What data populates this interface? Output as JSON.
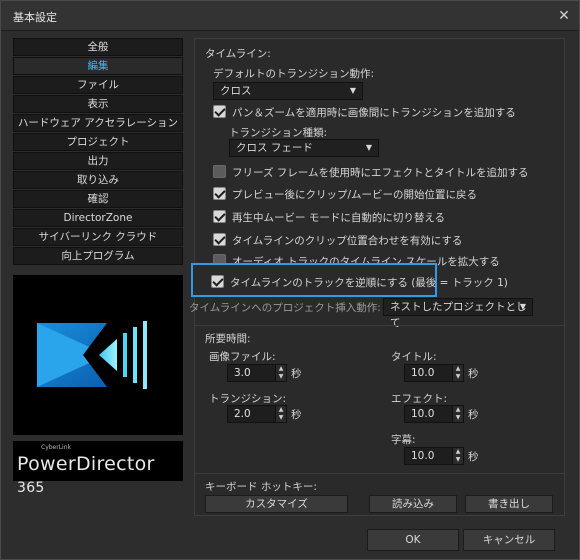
{
  "window": {
    "title": "基本設定",
    "close_icon": "close-icon"
  },
  "sidebar": {
    "items": [
      {
        "label": "全般"
      },
      {
        "label": "編集"
      },
      {
        "label": "ファイル"
      },
      {
        "label": "表示"
      },
      {
        "label": "ハードウェア アクセラレーション"
      },
      {
        "label": "プロジェクト"
      },
      {
        "label": "出力"
      },
      {
        "label": "取り込み"
      },
      {
        "label": "確認"
      },
      {
        "label": "DirectorZone"
      },
      {
        "label": "サイバーリンク クラウド"
      },
      {
        "label": "向上プログラム"
      }
    ],
    "active_index": 1,
    "accent_color": "#48b4f5"
  },
  "brand": {
    "small": "CyberLink",
    "name": "PowerDirector",
    "version": "365"
  },
  "timeline": {
    "section_label": "タイムライン:",
    "default_transition_label": "デフォルトのトランジション動作:",
    "default_transition_value": "クロス",
    "pan_zoom_label": "パン＆ズームを適用時に画像間にトランジションを追加する",
    "transition_type_label": "トランジション種類:",
    "transition_type_value": "クロス フェード",
    "freeze_label": "フリーズ フレームを使用時にエフェクトとタイトルを追加する",
    "preview_label": "プレビュー後にクリップ/ムービーの開始位置に戻る",
    "playback_label": "再生中ムービー モードに自動的に切り替える",
    "snap_label": "タイムラインのクリップ位置合わせを有効にする",
    "audio_partial_label": "オーディオ トラックのタイムライン スケールを拡大する",
    "reverse_label": "タイムラインのトラックを逆順にする (最後 = トラック 1)",
    "insert_partial_label": "タイムラインへのプロジェクト挿入動作:",
    "insert_partial_value": "ネストしたプロジェクトとして"
  },
  "duration": {
    "section_label": "所要時間:",
    "image_label": "画像ファイル:",
    "image_value": "3.0",
    "transition_label": "トランジション:",
    "transition_value": "2.0",
    "title_label": "タイトル:",
    "title_value": "10.0",
    "effect_label": "エフェクト:",
    "effect_value": "10.0",
    "subtitle_label": "字幕:",
    "subtitle_value": "10.0",
    "unit": "秒"
  },
  "hotkeys": {
    "label": "キーボード ホットキー:",
    "customize": "カスタマイズ",
    "import": "読み込み",
    "export": "書き出し"
  },
  "footer": {
    "ok": "OK",
    "cancel": "キャンセル"
  }
}
